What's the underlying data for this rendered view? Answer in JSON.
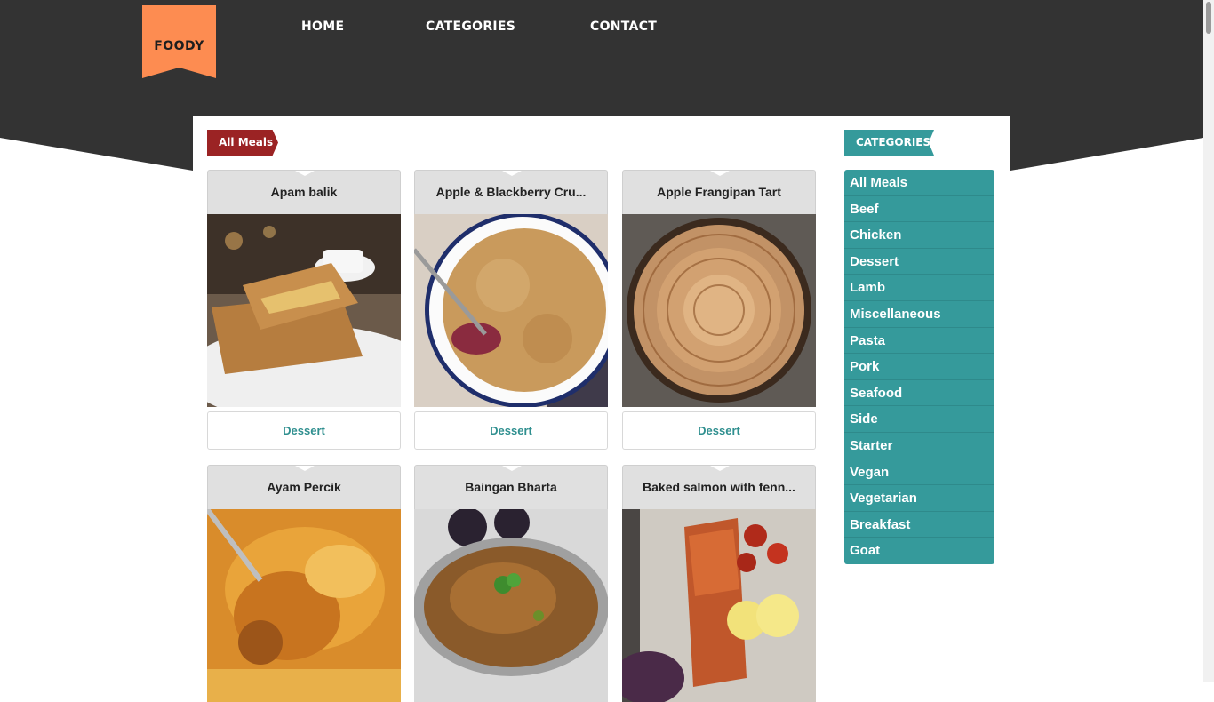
{
  "brand": {
    "logo_text": "FOODY"
  },
  "nav": {
    "items": [
      "HOME",
      "CATEGORIES",
      "CONTACT"
    ]
  },
  "main": {
    "section_label": "All Meals",
    "meals": [
      {
        "name": "Apam balik",
        "category": "Dessert"
      },
      {
        "name": "Apple & Blackberry Cru...",
        "category": "Dessert"
      },
      {
        "name": "Apple Frangipan Tart",
        "category": "Dessert"
      },
      {
        "name": "Ayam Percik",
        "category": ""
      },
      {
        "name": "Baingan Bharta",
        "category": ""
      },
      {
        "name": "Baked salmon with fenn...",
        "category": ""
      }
    ]
  },
  "sidebar": {
    "heading": "CATEGORIES",
    "categories": [
      "All Meals",
      "Beef",
      "Chicken",
      "Dessert",
      "Lamb",
      "Miscellaneous",
      "Pasta",
      "Pork",
      "Seafood",
      "Side",
      "Starter",
      "Vegan",
      "Vegetarian",
      "Breakfast",
      "Goat"
    ]
  },
  "colors": {
    "header_bg": "#333333",
    "logo_bg": "#fd8c51",
    "ribbon_red": "#9b2324",
    "accent_teal": "#359a9b"
  }
}
